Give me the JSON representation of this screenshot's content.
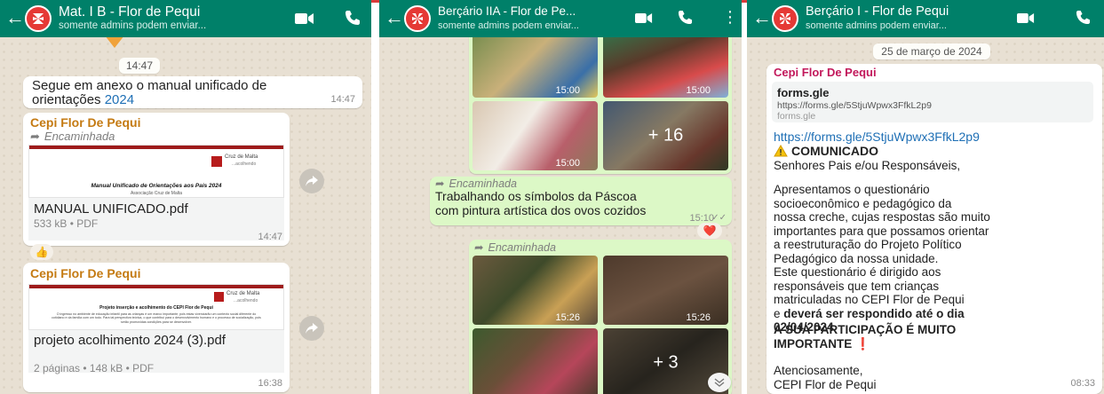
{
  "panel1": {
    "header": {
      "title": "Mat. I B - Flor de Pequi",
      "subtitle": "somente admins podem enviar..."
    },
    "time_chip": "14:47",
    "msg_text": {
      "line1": "Segue em anexo o manual unificado de",
      "line2a": "orientações ",
      "line2b": "2024",
      "time": "14:47"
    },
    "doc1": {
      "sender": "Cepi Flor De Pequi",
      "forwarded": "Encaminhada",
      "brand": "Cruz de Malta",
      "brand_sub": "...acolhendo",
      "preview_title": "Manual Unificado de Orientações aos Pais 2024",
      "preview_sub": "Associação Cruz de Malta",
      "filename": "MANUAL UNIFICADO.pdf",
      "meta": "533 kB • PDF",
      "time": "14:47"
    },
    "reaction": "👍",
    "doc2": {
      "sender": "Cepi Flor De Pequi",
      "brand": "Cruz de Malta",
      "brand_sub": "...acolhendo",
      "preview_title": "Projeto inserção e acolhimento do CEPI Flor de Pequi",
      "preview_body": "O ingresso no ambiente de educação infantil para as crianças é um marco importante, pois estas vivenciarão um contexto social diferente do cotidiano e da família com um todo. Para tal perspectiva teórica, o que contribui para o desenvolvimento humano e o processo de socialização, pois serão promovidas condições para se desenvolver.",
      "filename": "projeto acolhimento 2024 (3).pdf",
      "meta": "2 páginas • 148 kB • PDF",
      "time": "16:38"
    }
  },
  "panel2": {
    "header": {
      "title": "Berçário IIA - Flor de Pe...",
      "subtitle": "somente admins podem enviar..."
    },
    "photo_times": [
      "15:00",
      "15:00",
      "15:00"
    ],
    "more_count": "+ 16",
    "msg": {
      "forwarded": "Encaminhada",
      "line1": "Trabalhando os símbolos da Páscoa",
      "line2": "com pintura artística dos ovos cozidos",
      "time": "15:10",
      "reaction": "❤️"
    },
    "album2": {
      "forwarded": "Encaminhada",
      "times": [
        "15:26",
        "15:26"
      ],
      "more_count": "+ 3"
    }
  },
  "panel3": {
    "header": {
      "title": "Berçário I - Flor de Pequi",
      "subtitle": "somente admins podem enviar..."
    },
    "date_chip": "25 de março de 2024",
    "sender": "Cepi Flor De Pequi",
    "link_card": {
      "title": "forms.gle",
      "url": "https://forms.gle/5StjuWpwx3FfkL2p9",
      "domain": "forms.gle"
    },
    "link": "https://forms.gle/5StjuWpwx3FfkL2p9",
    "comunicado": "COMUNICADO",
    "greeting": "Senhores Pais e/ou Responsáveis,",
    "body": [
      "Apresentamos o questionário",
      "socioeconômico e pedagógico  da",
      "nossa creche, cujas respostas são muito",
      "importantes para que possamos orientar",
      "a reestruturação do Projeto Político",
      "Pedagógico da nossa unidade.",
      "Este questionário é dirigido aos",
      "responsáveis que tem  crianças",
      "matriculadas no CEPI Flor de Pequi"
    ],
    "deadline_a": "e ",
    "deadline_b": "deverá ser respondido até o dia",
    "deadline_date": "02/04/2024",
    "emphasis1": "A SUA PARTICIPAÇÃO É MUITO",
    "emphasis2": "IMPORTANTE ",
    "exclaim": "❗",
    "closing1": "Atenciosamente,",
    "closing2": "CEPI Flor de Pequi",
    "time": "08:33"
  }
}
